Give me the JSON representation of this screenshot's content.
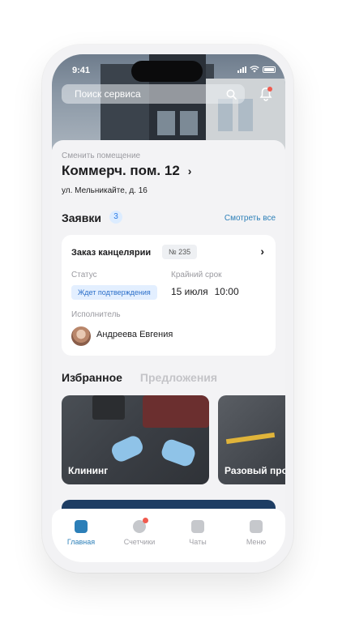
{
  "status_bar": {
    "time": "9:41"
  },
  "search": {
    "placeholder": "Поиск сервиса"
  },
  "premise": {
    "change_label": "Сменить помещение",
    "name": "Коммерч. пом. 12",
    "address": "ул. Мельникайте, д. 16"
  },
  "requests": {
    "title": "Заявки",
    "count": "3",
    "see_all": "Смотреть все",
    "card": {
      "title": "Заказ канцелярии",
      "number": "№ 235",
      "status_label": "Статус",
      "status_value": "Ждет подтверждения",
      "deadline_label": "Крайний срок",
      "deadline_date": "15 июля",
      "deadline_time": "10:00",
      "executor_label": "Исполнитель",
      "executor_name": "Андреева Евгения"
    }
  },
  "tabs": {
    "favorites": "Избранное",
    "offers": "Предложения"
  },
  "promos": [
    {
      "label": "Клининг"
    },
    {
      "label": "Разовый про"
    }
  ],
  "nav": {
    "home": "Главная",
    "meters": "Счетчики",
    "chats": "Чаты",
    "menu": "Меню"
  },
  "colors": {
    "accent": "#2c7fb8",
    "badge": "#f05a4f",
    "status_bg": "#e3efff"
  }
}
